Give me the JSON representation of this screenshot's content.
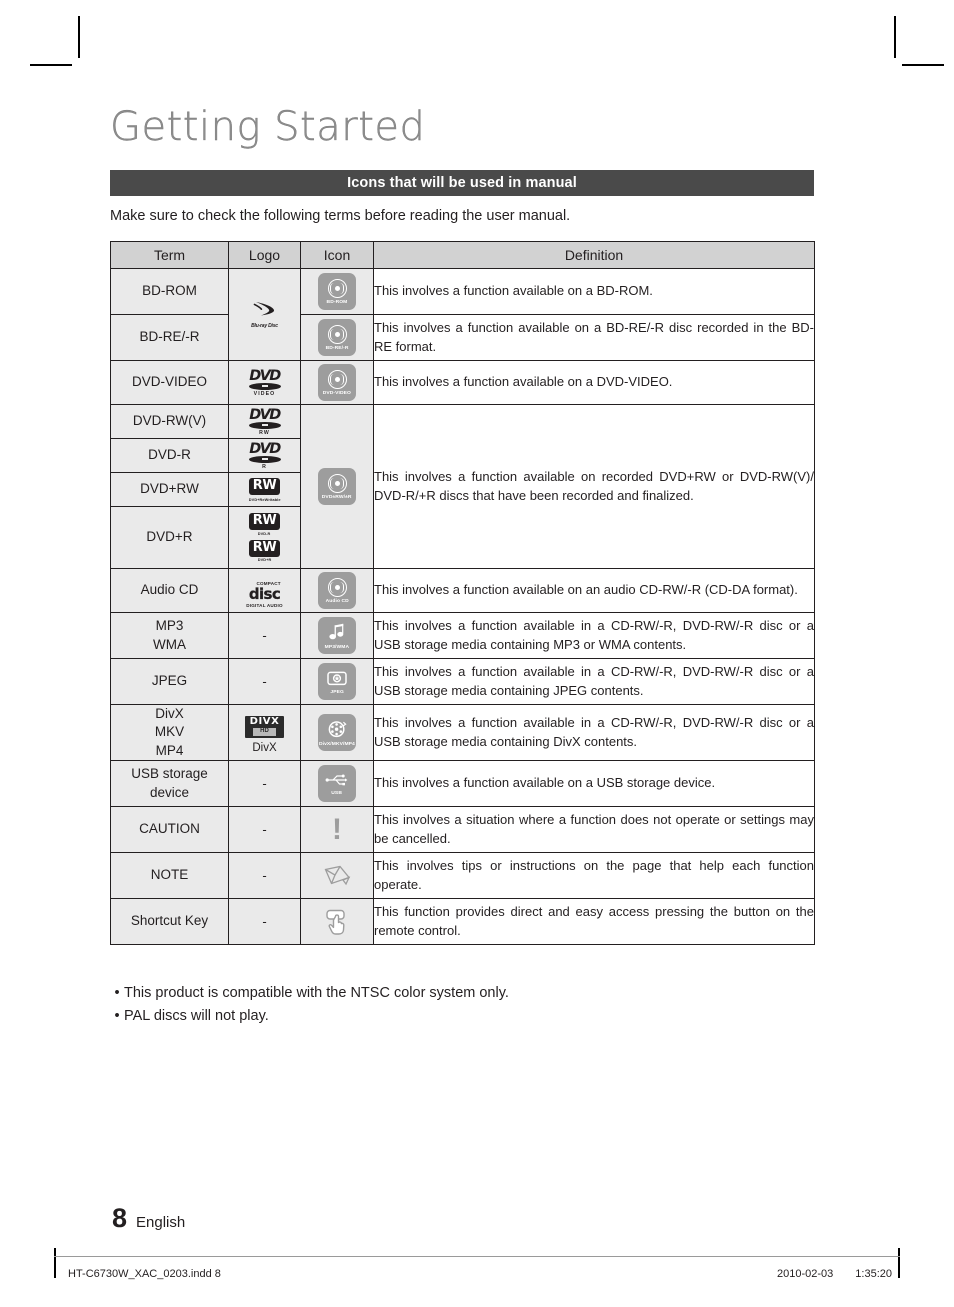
{
  "page": {
    "title": "Getting Started",
    "section_heading": "Icons that will be used in manual",
    "intro": "Make sure to check the following terms before reading the user manual.",
    "page_number": "8",
    "language": "English"
  },
  "table": {
    "headers": {
      "term": "Term",
      "logo": "Logo",
      "icon": "Icon",
      "definition": "Definition"
    },
    "rows": {
      "bd_rom": {
        "term": "BD-ROM",
        "icon_label": "BD-ROM",
        "definition": "This involves a function available on a BD-ROM."
      },
      "bd_re_r": {
        "term": "BD-RE/-R",
        "icon_label": "BD-RE/-R",
        "definition": "This involves a function available on a BD-RE/-R disc recorded in the BD-RE format."
      },
      "bluray_logo": {
        "mark": "♪",
        "text": "Blu-ray Disc"
      },
      "dvd_video": {
        "term": "DVD-VIDEO",
        "logo_word": "DVD",
        "logo_sub": "VIDEO",
        "icon_label": "DVD-VIDEO",
        "definition": "This involves a function available on a DVD-VIDEO."
      },
      "dvd_rw_v": {
        "term": "DVD-RW(V)",
        "logo_word": "DVD",
        "logo_sub": "RW"
      },
      "dvd_r": {
        "term": "DVD-R",
        "logo_word": "DVD",
        "logo_sub": "R"
      },
      "dvd_plus_rw": {
        "term": "DVD+RW",
        "logo_word": "RW",
        "logo_sub": "DVD+ReWritable"
      },
      "dvd_plus_r": {
        "term": "DVD+R",
        "logo_word_1": "RW",
        "logo_sub_1": "DVD-R",
        "logo_word_2": "RW",
        "logo_sub_2": "DVD+R"
      },
      "dvd_group": {
        "icon_label": "DVD±RW/±R",
        "definition": "This involves a function available on recorded DVD+RW or DVD-RW(V)/ DVD-R/+R discs that have been recorded and finalized."
      },
      "audio_cd": {
        "term": "Audio CD",
        "logo_top": "COMPACT",
        "logo_word": "disc",
        "logo_bottom": "DIGITAL AUDIO",
        "icon_label": "Audio CD",
        "definition": "This involves a function available on an audio CD-RW/-R (CD-DA format)."
      },
      "mp3_wma": {
        "term_line1": "MP3",
        "term_line2": "WMA",
        "logo": "-",
        "icon_label": "MP3/WMA",
        "definition": "This involves a function available in a CD-RW/-R, DVD-RW/-R disc or a USB storage media containing MP3 or WMA contents."
      },
      "jpeg": {
        "term": "JPEG",
        "logo": "-",
        "icon_label": "JPEG",
        "definition": "This involves a function available in a CD-RW/-R, DVD-RW/-R disc or a USB storage media containing JPEG contents."
      },
      "divx": {
        "term_line1": "DivX",
        "term_line2": "MKV",
        "term_line3": "MP4",
        "logo_word": "DIVX",
        "logo_hd": "HD",
        "logo_caption": "DivX",
        "icon_label": "DivX/MKV/MP4",
        "definition": "This involves a function available in a CD-RW/-R, DVD-RW/-R disc or a USB storage media containing DivX contents."
      },
      "usb": {
        "term_line1": "USB storage",
        "term_line2": "device",
        "logo": "-",
        "icon_label": "USB",
        "definition": "This involves a function available on a USB storage device."
      },
      "caution": {
        "term": "CAUTION",
        "logo": "-",
        "icon_glyph": "!",
        "definition": "This involves a situation where a function does not operate or settings may be cancelled."
      },
      "note": {
        "term": "NOTE",
        "logo": "-",
        "definition": "This involves tips or instructions on the page that help each function operate."
      },
      "shortcut": {
        "term": "Shortcut Key",
        "logo": "-",
        "definition": "This function provides direct and easy access pressing the button on the remote control."
      }
    }
  },
  "notes": {
    "bullet_char": "•",
    "items": [
      "This product is compatible with the NTSC color system only.",
      "PAL discs will not play."
    ]
  },
  "footer": {
    "file": "HT-C6730W_XAC_0203.indd   8",
    "date": "2010-02-03",
    "time": "1:35:20"
  },
  "colors": {
    "section_bar": "#4a4a4a",
    "header_cell": "#d2d2d2",
    "body_cell": "#eaeaea",
    "icon_grey": "#9d9d9d",
    "text": "#231f20",
    "title_grey": "#8d8d8d"
  }
}
